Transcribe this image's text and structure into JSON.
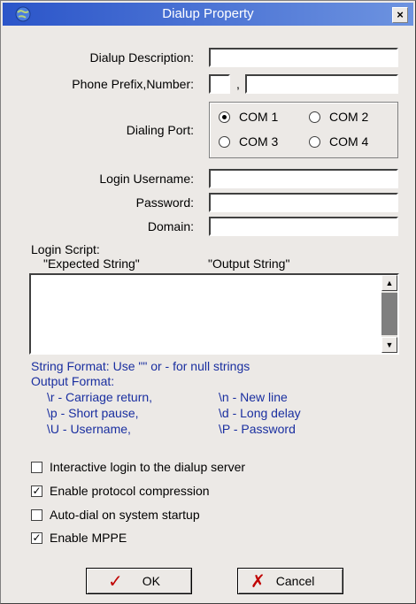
{
  "window": {
    "title": "Dialup Property",
    "close_glyph": "×"
  },
  "labels": {
    "description": "Dialup  Description:",
    "phone": "Phone Prefix,Number:",
    "comma": ",",
    "dialing_port": "Dialing Port:",
    "username": "Login Username:",
    "password": "Password:",
    "domain": "Domain:",
    "script": "Login Script:",
    "expected": "\"Expected String\"",
    "output": "\"Output String\""
  },
  "fields": {
    "description": "",
    "phone_prefix": "",
    "phone_number": "",
    "username": "",
    "password": "",
    "domain": "",
    "script": ""
  },
  "ports": [
    {
      "label": "COM 1",
      "checked": true
    },
    {
      "label": "COM 2",
      "checked": false
    },
    {
      "label": "COM 3",
      "checked": false
    },
    {
      "label": "COM 4",
      "checked": false
    }
  ],
  "help": {
    "string_format": "String Format: Use \"\" or - for null strings",
    "output_format": "Output Format:",
    "codes": [
      [
        "\\r - Carriage return,",
        "\\n - New line"
      ],
      [
        "\\p - Short pause,",
        "\\d - Long delay"
      ],
      [
        "\\U - Username,",
        "\\P - Password"
      ]
    ]
  },
  "options": [
    {
      "label": "Interactive login to the dialup server",
      "checked": false
    },
    {
      "label": "Enable protocol compression",
      "checked": true
    },
    {
      "label": "Auto-dial on system startup",
      "checked": false
    },
    {
      "label": "Enable MPPE",
      "checked": true
    }
  ],
  "buttons": {
    "ok": "OK",
    "cancel": "Cancel",
    "ok_icon": "✓",
    "cancel_icon": "✗"
  },
  "colors": {
    "help_text": "#1a2fa0",
    "ok_icon": "#c00000",
    "cancel_icon": "#c00000"
  }
}
